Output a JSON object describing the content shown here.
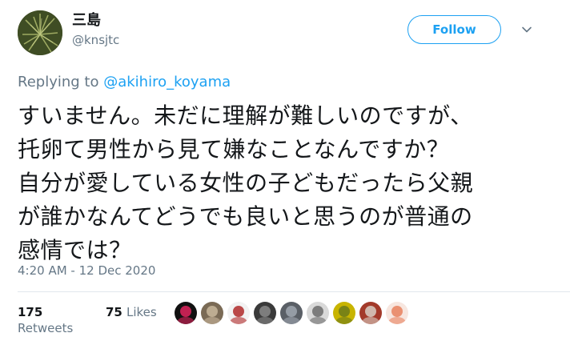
{
  "author": {
    "display_name": "三島",
    "handle": "@knsjtc"
  },
  "follow_label": "Follow",
  "replying": {
    "prefix": "Replying to ",
    "mention": "@akihiro_koyama"
  },
  "tweet_lines": [
    "すいません。未だに理解が難しいのですが、",
    "托卵て男性から見て嫌なことなんですか？",
    "自分が愛している女性の子どもだったら父親",
    "が誰かなんてどうでも良いと思うのが普通の",
    "感情では？"
  ],
  "timestamp": "4:20 AM - 12 Dec 2020",
  "stats": {
    "retweets_count": "175",
    "retweets_label": "Retweets",
    "likes_count": "75",
    "likes_label": "Likes"
  },
  "likers": [
    {
      "name": "liker-avatar-1",
      "colors": [
        "#111111",
        "#e0245e"
      ]
    },
    {
      "name": "liker-avatar-2",
      "colors": [
        "#7a6a55",
        "#c9b79c"
      ]
    },
    {
      "name": "liker-avatar-3",
      "colors": [
        "#f2f2f2",
        "#b02a2a"
      ]
    },
    {
      "name": "liker-avatar-4",
      "colors": [
        "#3a3a3a",
        "#8a8a8a"
      ]
    },
    {
      "name": "liker-avatar-5",
      "colors": [
        "#5a5f66",
        "#a0a7b0"
      ]
    },
    {
      "name": "liker-avatar-6",
      "colors": [
        "#d9d9d9",
        "#6b6b6b"
      ]
    },
    {
      "name": "liker-avatar-7",
      "colors": [
        "#c8b400",
        "#6b7a1a"
      ]
    },
    {
      "name": "liker-avatar-8",
      "colors": [
        "#a33a2a",
        "#d9cfc4"
      ]
    },
    {
      "name": "liker-avatar-9",
      "colors": [
        "#f7e6df",
        "#e8805e"
      ]
    }
  ],
  "colors": {
    "accent": "#1da1f2",
    "muted": "#657786",
    "text": "#14171a",
    "divider": "#e1e8ed"
  },
  "icons": {
    "caret": "chevron-down-icon"
  }
}
